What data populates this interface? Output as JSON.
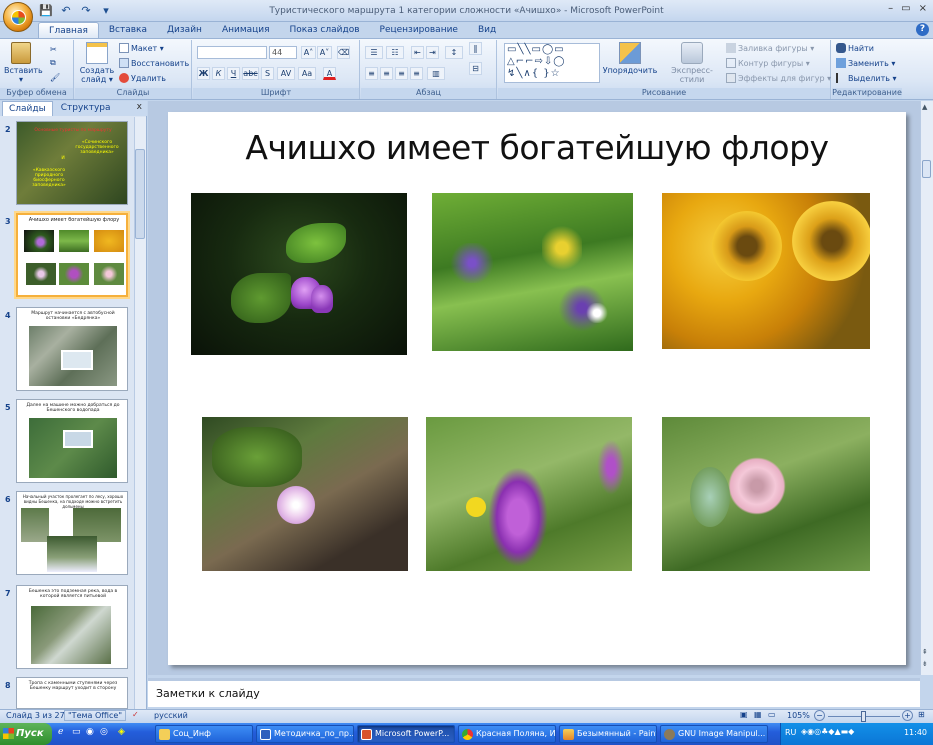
{
  "window": {
    "title": "Туристического маршрута 1 категории сложности «Ачишхо» - Microsoft PowerPoint",
    "controls": [
      "–",
      "▭",
      "×"
    ]
  },
  "tabs": [
    "Главная",
    "Вставка",
    "Дизайн",
    "Анимация",
    "Показ слайдов",
    "Рецензирование",
    "Вид"
  ],
  "ribbon": {
    "clipboard": {
      "paste": "Вставить",
      "label": "Буфер обмена"
    },
    "slides": {
      "create": "Создать",
      "create2": "слайд ▾",
      "layout": "Макет ▾",
      "reset": "Восстановить",
      "delete": "Удалить",
      "label": "Слайды"
    },
    "font": {
      "font_size": "44",
      "label": "Шрифт",
      "bold": "Ж",
      "italic": "К",
      "underline": "Ч",
      "strike": "abc",
      "shadow": "S",
      "spacing": "AV",
      "case": "Aa",
      "color": "A"
    },
    "paragraph": {
      "label": "Абзац"
    },
    "drawing": {
      "arrange": "Упорядочить",
      "styles": "Экспресс-стили",
      "fill": "Заливка фигуры ▾",
      "outline": "Контур фигуры ▾",
      "effects": "Эффекты для фигур ▾",
      "label": "Рисование"
    },
    "editing": {
      "find": "Найти",
      "replace": "Заменить ▾",
      "select": "Выделить ▾",
      "label": "Редактирование"
    }
  },
  "panel": {
    "tabs": [
      "Слайды",
      "Структура"
    ],
    "close": "x",
    "thumbs": [
      {
        "num": "2",
        "text": [
          "Основные туристы по маршруту",
          "«Сочинского государственного заповедника»",
          "И",
          "«Кавказского природного биосферного заповедника»"
        ]
      },
      {
        "num": "3",
        "text": [
          "Ачишхо имеет богатейшую флору"
        ]
      },
      {
        "num": "4",
        "text": [
          "Маршрут начинается с автобусной остановки «Бедрянка»"
        ]
      },
      {
        "num": "5",
        "text": [
          "Далее на машине можно добраться до Бешенского водопада"
        ]
      },
      {
        "num": "6",
        "text": [
          "Начальный участок пролегает по лесу, хорошо видны Бешенка, на подходе можно встретить дольмены"
        ]
      },
      {
        "num": "7",
        "text": [
          "Бешенка это подземная река, вода в которой является питьевой"
        ]
      },
      {
        "num": "8",
        "text": [
          "Тропа с каменными ступенями через Бешенку маршрут уходит в сторону"
        ]
      }
    ]
  },
  "slide": {
    "title": "Ачишхо имеет богатейшую флору"
  },
  "notes": {
    "placeholder": "Заметки к слайду"
  },
  "status": {
    "slide": "Слайд 3 из 27",
    "theme": "\"Тема Office\"",
    "language": "русский",
    "zoom": "105%",
    "zoom_fraction": 0.5
  },
  "taskbar": {
    "start": "Пуск",
    "buttons": [
      "Соц_Инф",
      "Методичка_по_пр...",
      "Microsoft PowerP...",
      "Красная Поляна, И...",
      "Безымянный - Paint",
      "GNU Image Manipul..."
    ],
    "time": "11:40",
    "lang": "RU"
  }
}
